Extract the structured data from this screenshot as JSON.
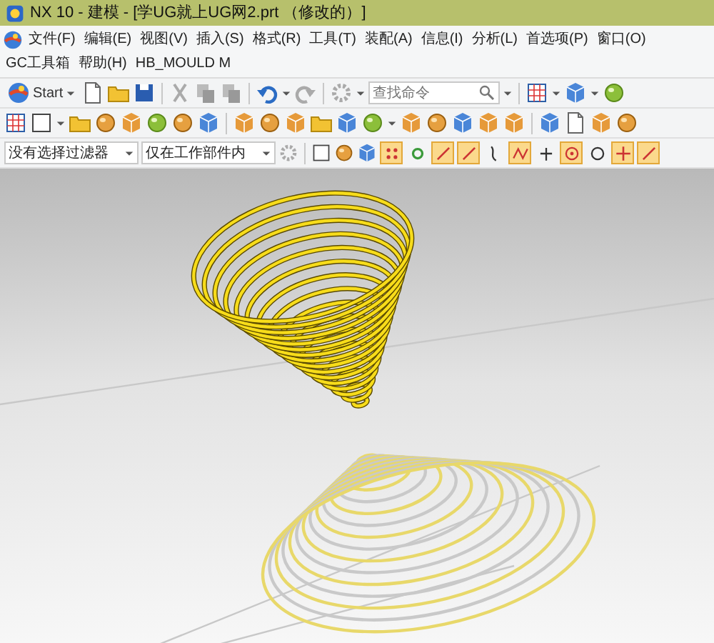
{
  "window": {
    "title": "NX 10 - 建模 - [学UG就上UG网2.prt （修改的）]"
  },
  "menu": [
    "文件(F)",
    "编辑(E)",
    "视图(V)",
    "插入(S)",
    "格式(R)",
    "工具(T)",
    "装配(A)",
    "信息(I)",
    "分析(L)",
    "首选项(P)",
    "窗口(O)",
    "GC工具箱",
    "帮助(H)",
    "HB_MOULD M"
  ],
  "toolbar": {
    "start_button": "Start",
    "search": {
      "placeholder": "查找命令"
    }
  },
  "selection_bar": {
    "type_filter": "没有选择过滤器",
    "scope_filter": "仅在工作部件内",
    "snap_buttons": [
      {
        "on": true
      },
      {
        "on": false
      },
      {
        "on": true
      },
      {
        "on": true
      },
      {
        "on": false
      },
      {
        "on": true
      },
      {
        "on": false
      },
      {
        "on": true
      },
      {
        "on": false
      },
      {
        "on": true
      },
      {
        "on": true
      }
    ]
  }
}
